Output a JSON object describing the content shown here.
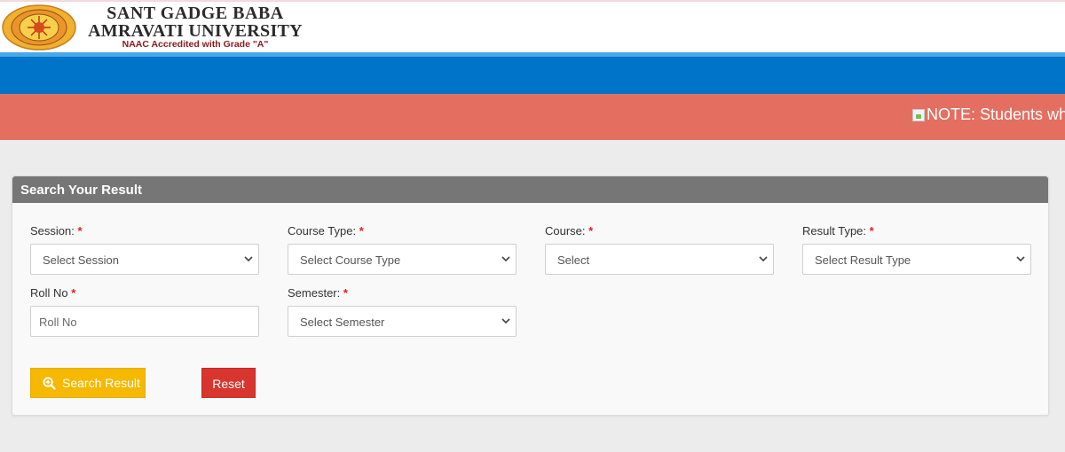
{
  "header": {
    "name_line1": "SANT GADGE BABA",
    "name_line2": "AMRAVATI UNIVERSITY",
    "naac": "NAAC Accredited with Grade \"A\""
  },
  "notice": {
    "text": "NOTE: Students who"
  },
  "panel": {
    "title": "Search Your Result",
    "fields": {
      "session": {
        "label": "Session:",
        "required": "*",
        "value": "Select Session"
      },
      "course_type": {
        "label": "Course Type:",
        "required": "*",
        "value": "Select Course Type"
      },
      "course": {
        "label": "Course:",
        "required": "*",
        "value": "Select"
      },
      "result_type": {
        "label": "Result Type:",
        "required": "*",
        "value": "Select Result Type"
      },
      "roll_no": {
        "label": "Roll No",
        "required": "*",
        "placeholder": "Roll No"
      },
      "semester": {
        "label": "Semester:",
        "required": "*",
        "value": "Select Semester"
      }
    },
    "buttons": {
      "search": "Search Result",
      "reset": "Reset"
    }
  },
  "colors": {
    "blue_bar": "#0074c8",
    "notice_bar": "#e46f60",
    "panel_header": "#767676",
    "search_button": "#f6b800",
    "reset_button": "#d7352d",
    "required_mark": "#e02020"
  },
  "icons": {
    "logo": "university-seal-logo",
    "notice": "broken-image-icon",
    "dropdown": "chevron-down-icon",
    "search": "search-plus-icon"
  }
}
